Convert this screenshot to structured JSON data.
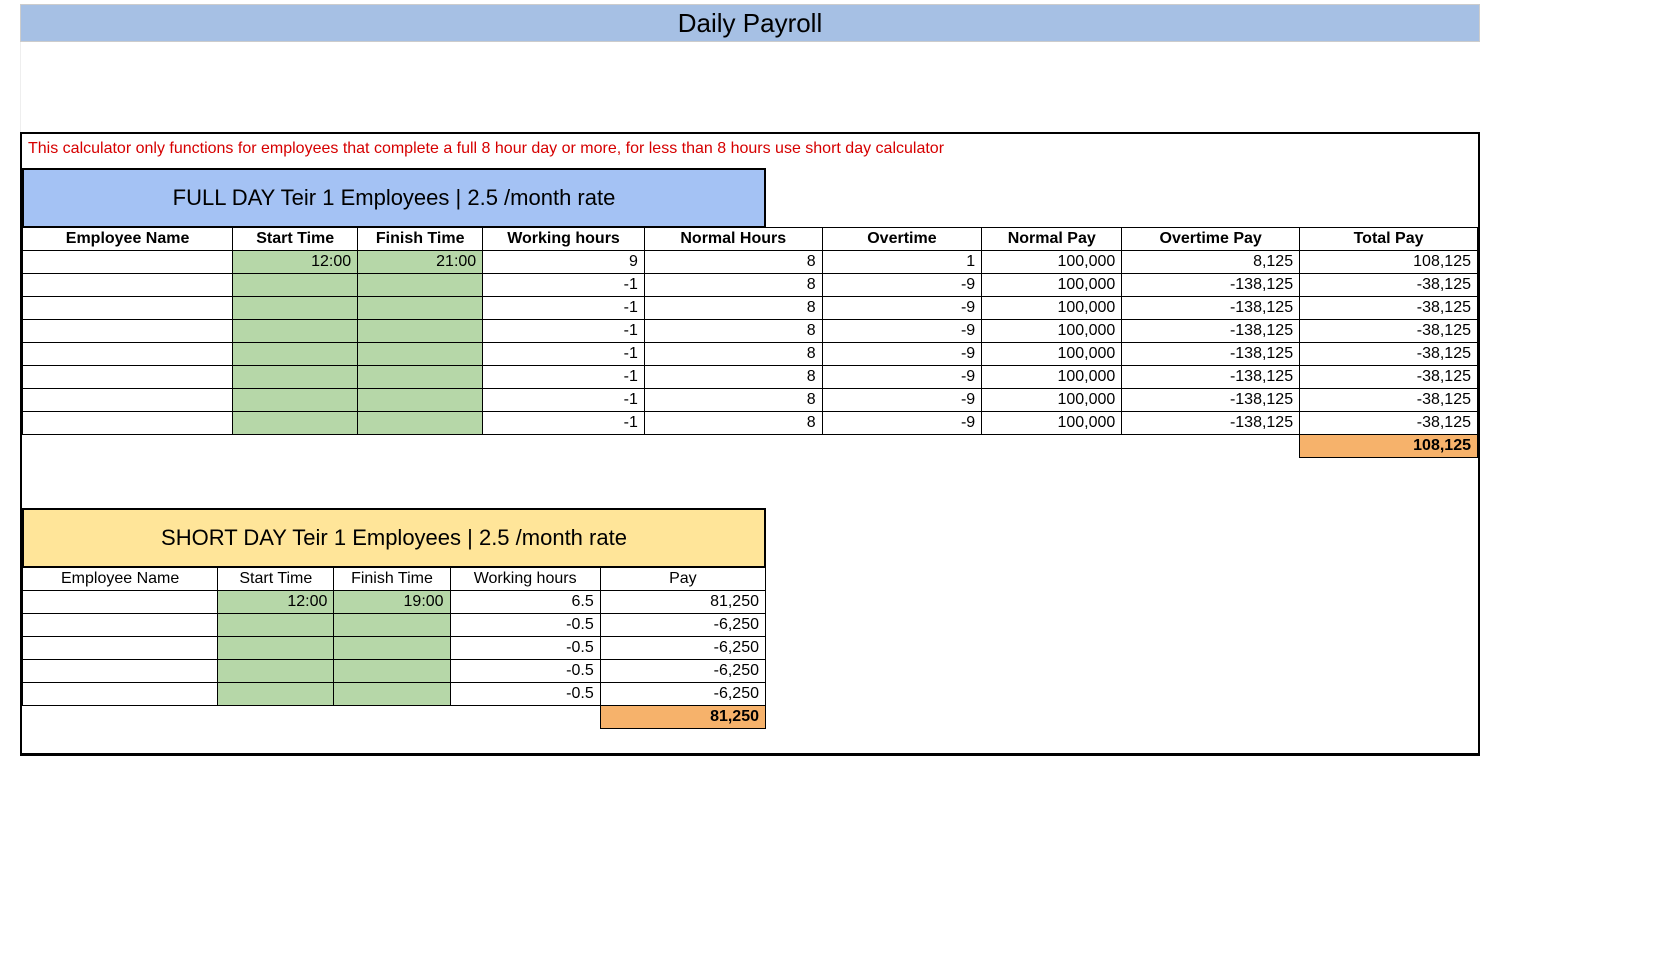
{
  "title": "Daily Payroll",
  "note": "This calculator only functions for employees that complete a full 8 hour day or more, for less than 8 hours use short day calculator",
  "full": {
    "title": "FULL DAY Teir 1 Employees | 2.5 /month rate",
    "headers": {
      "emp": "Employee Name",
      "start": "Start Time",
      "finish": "Finish Time",
      "work": "Working hours",
      "normal": "Normal Hours",
      "over": "Overtime",
      "npay": "Normal Pay",
      "opay": "Overtime Pay",
      "tpay": "Total Pay"
    },
    "rows": [
      {
        "emp": "",
        "start": "12:00",
        "finish": "21:00",
        "work": "9",
        "normal": "8",
        "over": "1",
        "npay": "100,000",
        "opay": "8,125",
        "tpay": "108,125"
      },
      {
        "emp": "",
        "start": "",
        "finish": "",
        "work": "-1",
        "normal": "8",
        "over": "-9",
        "npay": "100,000",
        "opay": "-138,125",
        "tpay": "-38,125"
      },
      {
        "emp": "",
        "start": "",
        "finish": "",
        "work": "-1",
        "normal": "8",
        "over": "-9",
        "npay": "100,000",
        "opay": "-138,125",
        "tpay": "-38,125"
      },
      {
        "emp": "",
        "start": "",
        "finish": "",
        "work": "-1",
        "normal": "8",
        "over": "-9",
        "npay": "100,000",
        "opay": "-138,125",
        "tpay": "-38,125"
      },
      {
        "emp": "",
        "start": "",
        "finish": "",
        "work": "-1",
        "normal": "8",
        "over": "-9",
        "npay": "100,000",
        "opay": "-138,125",
        "tpay": "-38,125"
      },
      {
        "emp": "",
        "start": "",
        "finish": "",
        "work": "-1",
        "normal": "8",
        "over": "-9",
        "npay": "100,000",
        "opay": "-138,125",
        "tpay": "-38,125"
      },
      {
        "emp": "",
        "start": "",
        "finish": "",
        "work": "-1",
        "normal": "8",
        "over": "-9",
        "npay": "100,000",
        "opay": "-138,125",
        "tpay": "-38,125"
      },
      {
        "emp": "",
        "start": "",
        "finish": "",
        "work": "-1",
        "normal": "8",
        "over": "-9",
        "npay": "100,000",
        "opay": "-138,125",
        "tpay": "-38,125"
      }
    ],
    "total": "108,125"
  },
  "short": {
    "title": "SHORT DAY Teir 1 Employees | 2.5 /month rate",
    "headers": {
      "emp": "Employee Name",
      "start": "Start Time",
      "finish": "Finish Time",
      "work": "Working hours",
      "pay": "Pay"
    },
    "rows": [
      {
        "emp": "",
        "start": "12:00",
        "finish": "19:00",
        "work": "6.5",
        "pay": "81,250"
      },
      {
        "emp": "",
        "start": "",
        "finish": "",
        "work": "-0.5",
        "pay": "-6,250"
      },
      {
        "emp": "",
        "start": "",
        "finish": "",
        "work": "-0.5",
        "pay": "-6,250"
      },
      {
        "emp": "",
        "start": "",
        "finish": "",
        "work": "-0.5",
        "pay": "-6,250"
      },
      {
        "emp": "",
        "start": "",
        "finish": "",
        "work": "-0.5",
        "pay": "-6,250"
      }
    ],
    "total": "81,250"
  }
}
